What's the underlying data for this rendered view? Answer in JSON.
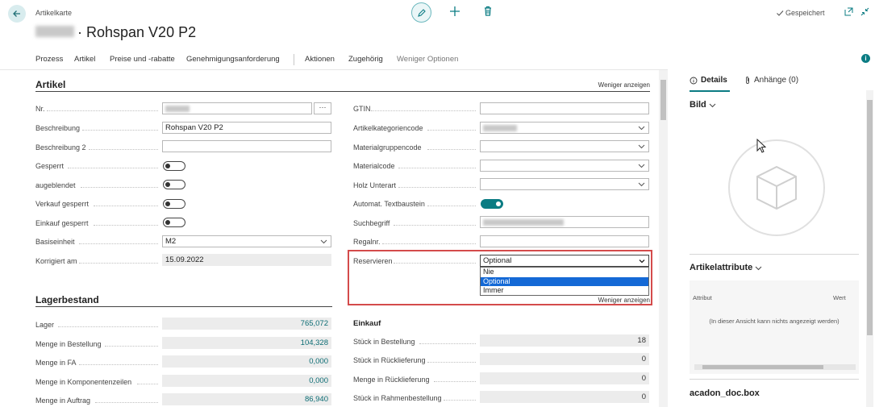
{
  "header": {
    "breadcrumb": "Artikelkarte",
    "title": "· Rohspan V20 P2",
    "saved_label": "Gespeichert"
  },
  "actions": [
    {
      "label": "Prozess"
    },
    {
      "label": "Artikel"
    },
    {
      "label": "Preise und -rabatte"
    },
    {
      "label": "Genehmigungsanforderung"
    },
    {
      "label": "Aktionen"
    },
    {
      "label": "Zugehörig"
    },
    {
      "label": "Weniger Optionen"
    }
  ],
  "artikel": {
    "title": "Artikel",
    "less_link": "Weniger anzeigen",
    "left": {
      "nr_label": "Nr.",
      "beschreibung_label": "Beschreibung",
      "beschreibung_value": "Rohspan V20 P2",
      "beschreibung2_label": "Beschreibung 2",
      "gesperrt_label": "Gesperrt",
      "ausgeblendet_label": "augeblendet",
      "verkauf_gesperrt_label": "Verkauf gesperrt",
      "einkauf_gesperrt_label": "Einkauf gesperrt",
      "basiseinheit_label": "Basiseinheit",
      "basiseinheit_value": "M2",
      "korrigiert_label": "Korrigiert am",
      "korrigiert_value": "15.09.2022",
      "ellipsis": "···"
    },
    "right": {
      "gtin_label": "GTIN",
      "artikelkategorie_label": "Artikelkategoriencode",
      "materialgruppe_label": "Materialgruppencode",
      "materialcode_label": "Materialcode",
      "holz_label": "Holz Unterart",
      "textbaustein_label": "Automat. Textbaustein",
      "suchbegriff_label": "Suchbegriff",
      "regalnr_label": "Regalnr.",
      "reservieren_label": "Reservieren",
      "reservieren_value": "Optional",
      "reservieren_options": [
        "Nie",
        "Optional",
        "Immer"
      ],
      "less_link": "Weniger anzeigen"
    }
  },
  "lager": {
    "title": "Lagerbestand",
    "rows": [
      {
        "label": "Lager",
        "value": "765,072"
      },
      {
        "label": "Menge in Bestellung",
        "value": "104,328"
      },
      {
        "label": "Menge in FA",
        "value": "0,000"
      },
      {
        "label": "Menge in Komponentenzeilen",
        "value": "0,000"
      },
      {
        "label": "Menge in Auftrag",
        "value": "86,940"
      }
    ],
    "einkauf_title": "Einkauf",
    "einkauf_rows": [
      {
        "label": "Stück in Bestellung",
        "value": "18"
      },
      {
        "label": "Stück in Rücklieferung",
        "value": "0"
      },
      {
        "label": "Menge in Rücklieferung",
        "value": "0"
      },
      {
        "label": "Stück in Rahmenbestellung",
        "value": "0"
      }
    ]
  },
  "details_pane": {
    "tab_details": "Details",
    "tab_attachments": "Anhänge (0)",
    "bild_title": "Bild",
    "attributes_title": "Artikelattribute",
    "attr_col_attribut": "Attribut",
    "attr_col_wert": "Wert",
    "attr_empty": "(In dieser Ansicht kann nichts angezeigt werden)",
    "docbox_title": "acadon_doc.box"
  },
  "colors": {
    "accent": "#0b7c83",
    "highlight_border": "#d44b4b",
    "selected_option": "#1469d6"
  }
}
